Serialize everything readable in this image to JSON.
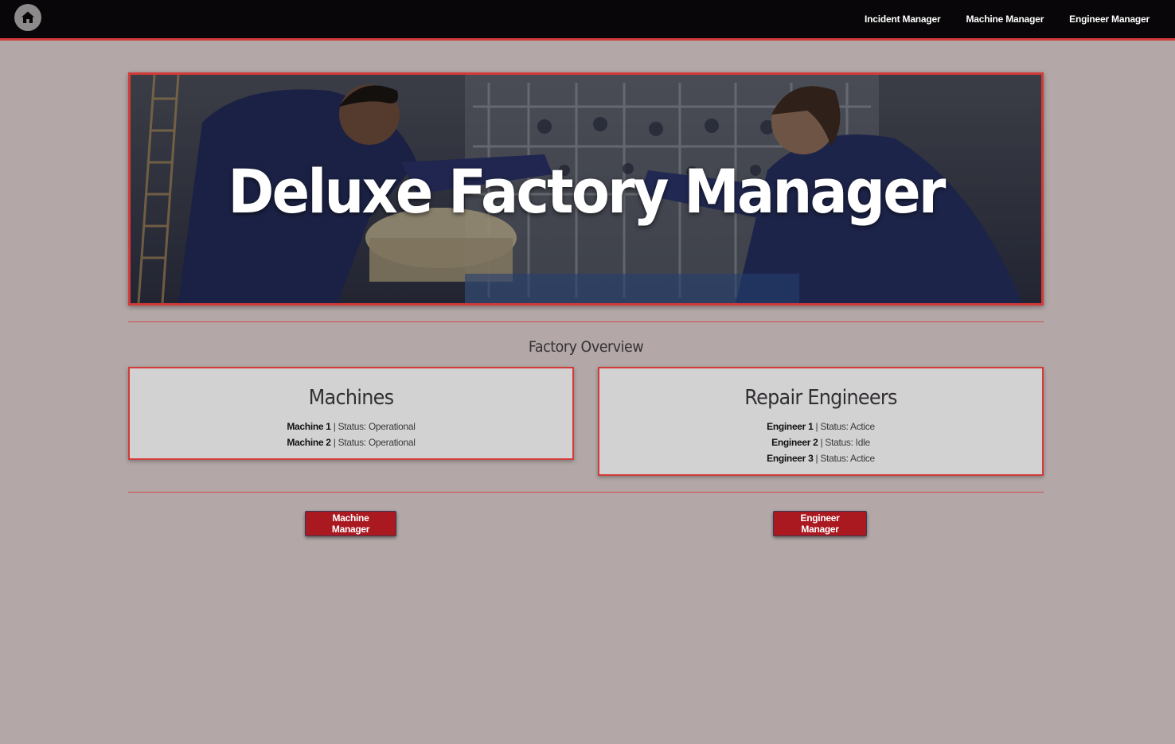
{
  "nav": {
    "home_icon": "home-icon",
    "links": [
      "Incident Manager",
      "Machine Manager",
      "Engineer Manager"
    ]
  },
  "hero": {
    "title": "Deluxe Factory Manager"
  },
  "overview": {
    "title": "Factory Overview"
  },
  "machines": {
    "title": "Machines",
    "items": [
      {
        "name": "Machine 1",
        "status": "| Status: Operational"
      },
      {
        "name": "Machine 2",
        "status": "| Status: Operational"
      }
    ]
  },
  "engineers": {
    "title": "Repair Engineers",
    "items": [
      {
        "name": "Engineer 1",
        "status": "| Status: Actice"
      },
      {
        "name": "Engineer 2",
        "status": "| Status: Idle"
      },
      {
        "name": "Engineer 3",
        "status": "| Status: Actice"
      }
    ]
  },
  "buttons": {
    "machine_manager": "Machine Manager",
    "engineer_manager": "Engineer Manager"
  },
  "colors": {
    "accent": "#d33a3a",
    "button": "#aa1820",
    "navbar": "#080608",
    "background": "#b3a8a7",
    "card": "#d3d2d3"
  }
}
